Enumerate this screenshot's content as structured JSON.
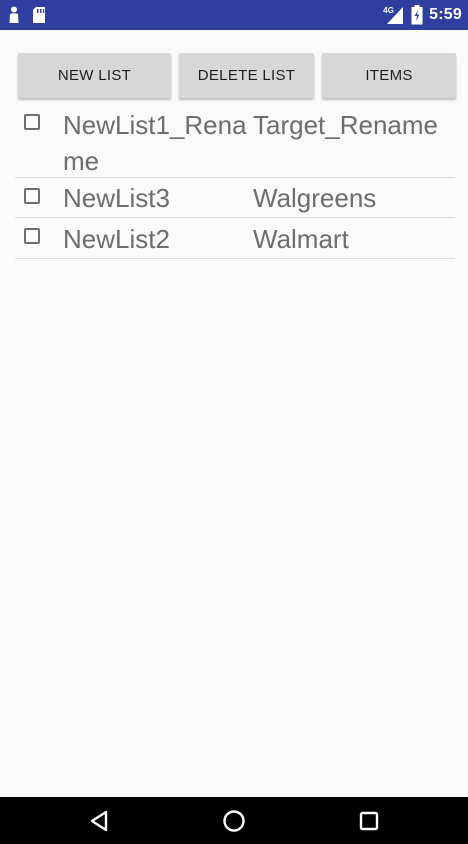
{
  "status_bar": {
    "time": "5:59",
    "network_type": "4G",
    "icons": [
      "person-icon",
      "sd-card-icon",
      "signal-icon",
      "battery-charging-icon"
    ]
  },
  "toolbar": {
    "new_list_label": "NEW LIST",
    "delete_list_label": "DELETE LIST",
    "items_label": "ITEMS"
  },
  "lists": [
    {
      "name": "NewList1_Rename",
      "store": "Target_Rename",
      "checked": false
    },
    {
      "name": "NewList3",
      "store": "Walgreens",
      "checked": false
    },
    {
      "name": "NewList2",
      "store": "Walmart",
      "checked": false
    }
  ],
  "nav_bar": {
    "icons": [
      "back-icon",
      "home-icon",
      "recents-icon"
    ]
  },
  "colors": {
    "status_bar": "#303f9f",
    "background": "#fafafa",
    "button": "#d6d7d7",
    "list_text": "#6d6d6d"
  }
}
